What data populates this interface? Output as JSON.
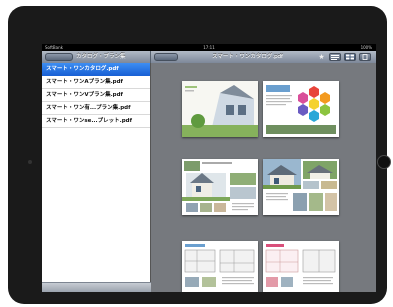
{
  "status_bar": {
    "carrier": "SoftBank",
    "time": "17:11",
    "battery": "100%"
  },
  "left_panel": {
    "back_label": "",
    "title": "カタログ・プラン集",
    "files": [
      {
        "label": "スマート・ワンカタログ.pdf",
        "selected": true
      },
      {
        "label": "スマート・ワンAプラン集.pdf",
        "selected": false
      },
      {
        "label": "スマート・ワンVプラン集.pdf",
        "selected": false
      },
      {
        "label": "スマート・ワン有...プラン集.pdf",
        "selected": false
      },
      {
        "label": "スマート・ワンse...プレット.pdf",
        "selected": false
      }
    ]
  },
  "viewer": {
    "back_label": "",
    "title": "スマート・ワンカタログ.pdf",
    "toolbar_icons": [
      "star-icon",
      "outline-view-icon",
      "grid-view-icon",
      "single-page-icon"
    ],
    "pages": [
      {
        "name": "page-1",
        "kind": "cover"
      },
      {
        "name": "page-2",
        "kind": "hexagons"
      },
      {
        "name": "page-3",
        "kind": "house-photos"
      },
      {
        "name": "page-4",
        "kind": "house-photos"
      },
      {
        "name": "page-5",
        "kind": "plans"
      },
      {
        "name": "page-6",
        "kind": "plans"
      }
    ]
  },
  "colors": {
    "accent": "#1a62d6",
    "viewer_bg": "#76797e",
    "bar": "#8d97a6"
  }
}
